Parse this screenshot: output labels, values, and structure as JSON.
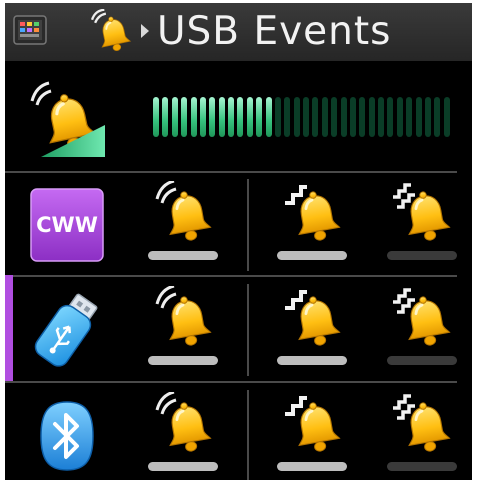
{
  "header": {
    "title": "USB Events",
    "app_icon": "app-grid-icon",
    "bell_icon": "ringing-bell-icon",
    "arrow_icon": "arrow-right-icon"
  },
  "volume": {
    "icon": "volume-bell-icon",
    "segments_total": 32,
    "segments_active": 13,
    "level": 0.4,
    "active_color": "#36c27d",
    "inactive_color": "#0a3d27"
  },
  "rows": [
    {
      "name": "cww",
      "icon_label": "CWW",
      "cells": [
        {
          "icon": "ringing-bell-icon",
          "enabled": true
        },
        {
          "icon": "zigzag-bell-icon",
          "enabled": true
        },
        {
          "icon": "double-zigzag-bell-icon",
          "enabled": false
        }
      ]
    },
    {
      "name": "usb",
      "icon": "usb-stick-icon",
      "cells": [
        {
          "icon": "ringing-bell-icon",
          "enabled": true
        },
        {
          "icon": "zigzag-bell-icon",
          "enabled": true
        },
        {
          "icon": "double-zigzag-bell-icon",
          "enabled": false
        }
      ]
    },
    {
      "name": "bluetooth",
      "icon": "bluetooth-icon",
      "cells": [
        {
          "icon": "ringing-bell-icon",
          "enabled": true
        },
        {
          "icon": "zigzag-bell-icon",
          "enabled": true
        },
        {
          "icon": "double-zigzag-bell-icon",
          "enabled": false
        }
      ]
    }
  ],
  "colors": {
    "accent": "#b04ee0",
    "bell": "#ffc21a"
  }
}
